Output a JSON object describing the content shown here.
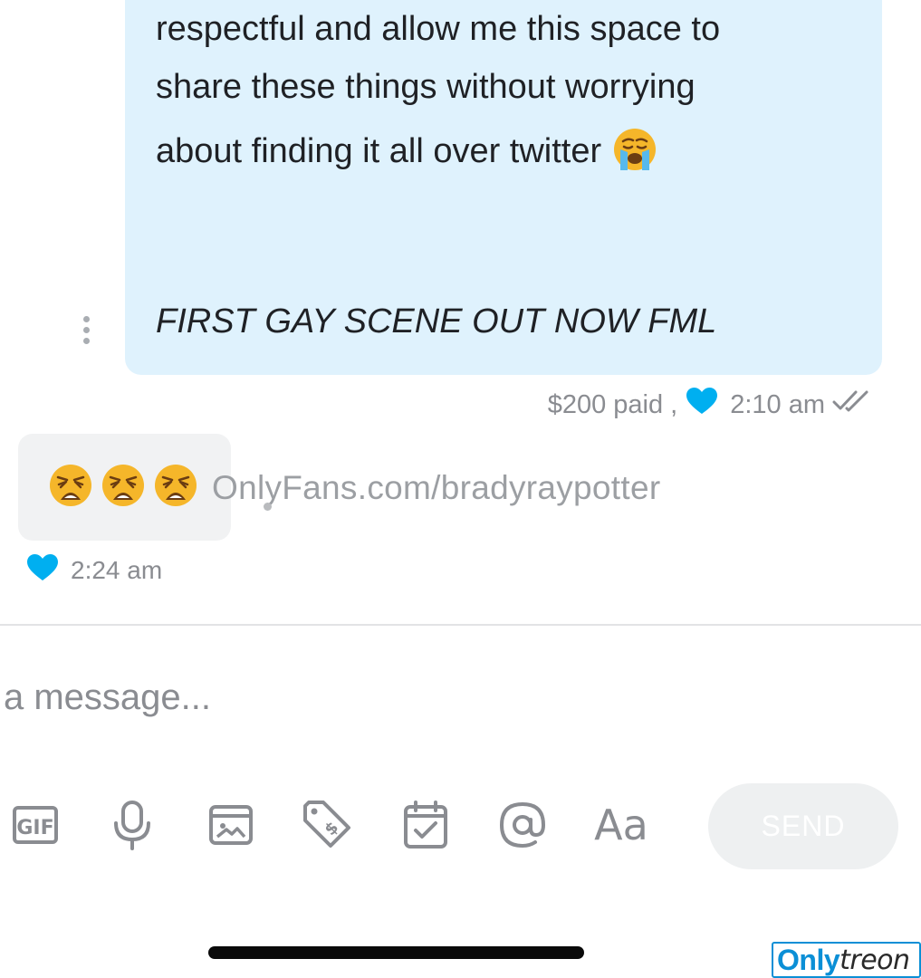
{
  "conversation": {
    "sent_message": {
      "lines": [
        "respectful and allow me this space to",
        "share these things without worrying",
        "about finding it all over twitter"
      ],
      "line3_emoji": "loudly-crying-face-emoji",
      "italic_line": "FIRST GAY SCENE OUT NOW FML",
      "paid_text": "$200 paid ,",
      "time": "2:10 am",
      "read_status_icon": "double-check-icon"
    },
    "received_message": {
      "emoji": [
        "weary-face-emoji",
        "weary-face-emoji",
        "weary-face-emoji"
      ],
      "time": "2:24 am"
    },
    "watermark_text": "OnlyFans.com/bradyraypotter"
  },
  "composer": {
    "placeholder": "a message...",
    "tools": [
      "gif-icon",
      "microphone-icon",
      "image-icon",
      "price-tag-icon",
      "calendar-check-icon",
      "at-sign-icon",
      "text-format-icon"
    ],
    "format_label": "Aa",
    "send_label": "SEND"
  },
  "logo": {
    "part1": "Only",
    "part2": "treon"
  },
  "colors": {
    "sent_bubble": "#dff2fd",
    "received_bubble": "#f1f2f3",
    "heart": "#00aff0",
    "meta_text": "#8a8c91",
    "icon": "#8a8c91",
    "send_button": "#eef0f1",
    "logo_blue": "#0b8fd6"
  }
}
